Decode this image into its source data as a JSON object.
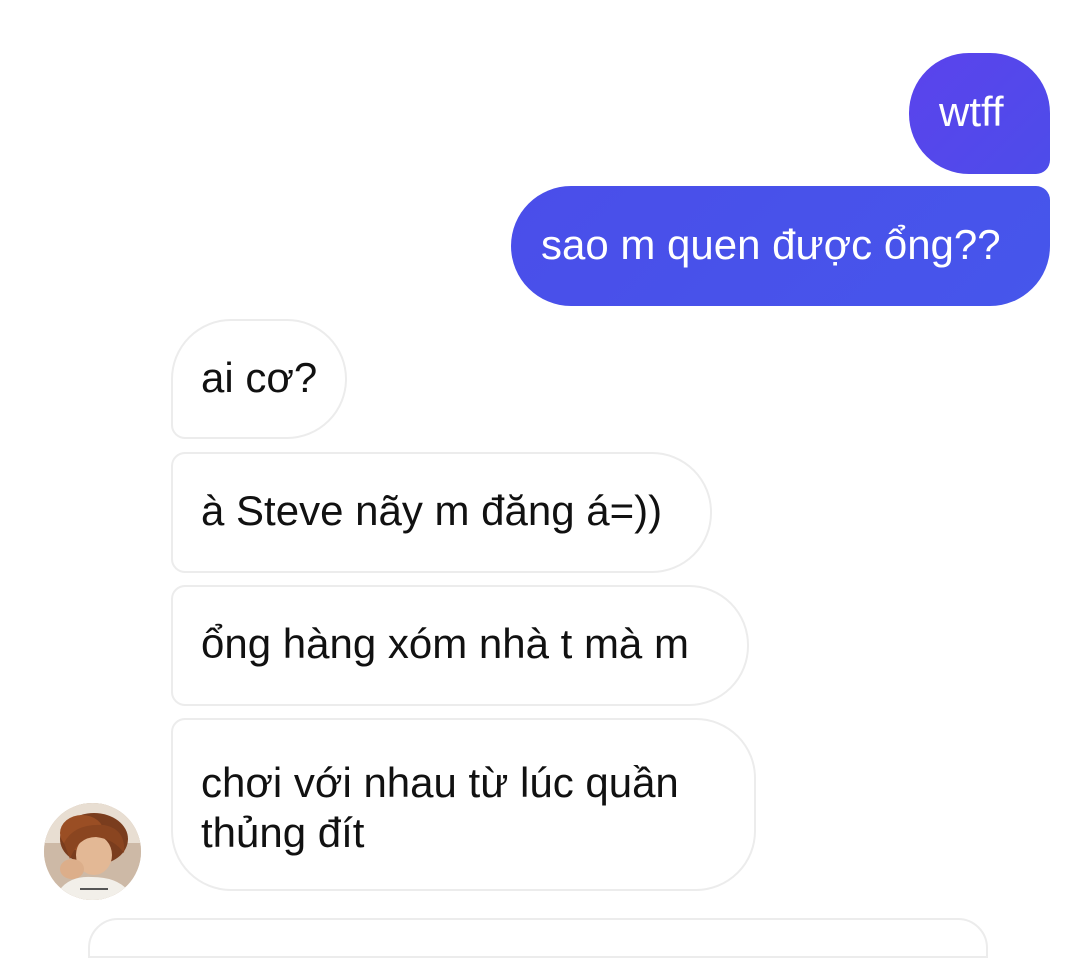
{
  "conversation": {
    "messages": [
      {
        "direction": "sent",
        "text": "wtff"
      },
      {
        "direction": "sent",
        "text": "sao m quen được ổng??"
      },
      {
        "direction": "received",
        "text": "ai cơ?"
      },
      {
        "direction": "received",
        "text": "à Steve nãy m đăng á=))"
      },
      {
        "direction": "received",
        "text": "ổng hàng xóm nhà t mà m"
      },
      {
        "direction": "received",
        "text": "chơi với nhau từ lúc quần thủng đít"
      }
    ]
  },
  "colors": {
    "sent_bubble": "#4d4cea",
    "received_border": "#ececec",
    "background": "#ffffff"
  }
}
